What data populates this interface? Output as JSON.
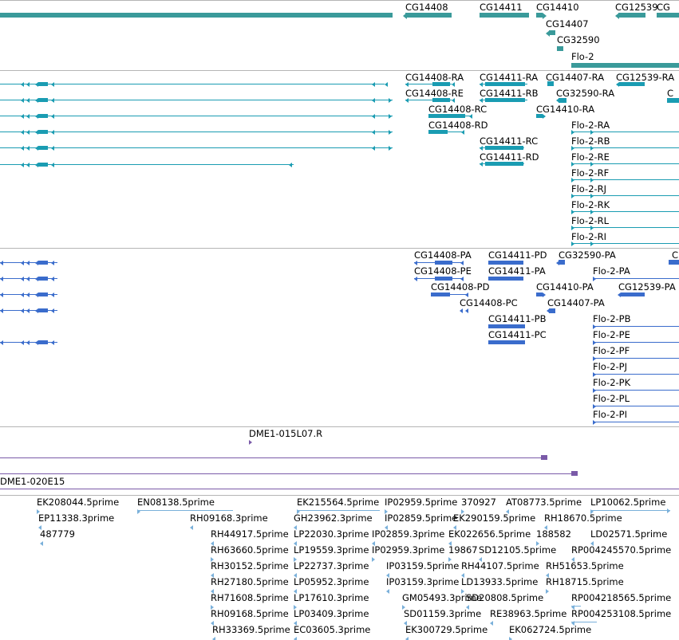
{
  "colors": {
    "gene": "#3a9a9a",
    "transcript": "#1a9cb2",
    "protein": "#3a6ccc",
    "clone": "#7a5aa8",
    "est": "#7ab0da",
    "separator": "#b5b5b5"
  },
  "tracks": {
    "genes": {
      "labels": [
        "CG14408",
        "CG14411",
        "CG14410",
        "CG14407",
        "CG12539",
        "CG32590",
        "Flo-2",
        "CG"
      ]
    },
    "transcripts": {
      "labels": [
        "CG14408-RA",
        "CG14408-RE",
        "CG14408-RC",
        "CG14408-RD",
        "CG14411-RA",
        "CG14411-RB",
        "CG14411-RC",
        "CG14411-RD",
        "CG14407-RA",
        "CG14410-RA",
        "CG12539-RA",
        "CG32590-RA",
        "Flo-2-RA",
        "Flo-2-RB",
        "Flo-2-RE",
        "Flo-2-RF",
        "Flo-2-RJ",
        "Flo-2-RK",
        "Flo-2-RL",
        "Flo-2-RI",
        "C"
      ]
    },
    "proteins": {
      "labels": [
        "CG14408-PA",
        "CG14408-PE",
        "CG14408-PD",
        "CG14408-PC",
        "CG14411-PD",
        "CG14411-PA",
        "CG14411-PB",
        "CG14411-PC",
        "CG32590-PA",
        "CG14410-PA",
        "CG12539-PA",
        "CG14407-PA",
        "Flo-2-PA",
        "Flo-2-PB",
        "Flo-2-PE",
        "Flo-2-PF",
        "Flo-2-PJ",
        "Flo-2-PK",
        "Flo-2-PL",
        "Flo-2-PI",
        "C"
      ]
    },
    "clones": {
      "labels": [
        "DME1-015L07.R",
        "DME1-020E15"
      ]
    },
    "ests": {
      "labels": [
        "EK208044.5prime",
        "EP11338.3prime",
        "487779",
        "EN08138.5prime",
        "RH09168.3prime",
        "RH44917.5prime",
        "RH63660.5prime",
        "RH30152.5prime",
        "RH27180.5prime",
        "RH71608.5prime",
        "RH09168.5prime",
        "RH33369.5prime",
        "EK215564.5prime",
        "GH23962.3prime",
        "LP22030.3prime",
        "LP19559.3prime",
        "LP22737.3prime",
        "LP05952.3prime",
        "LP17610.3prime",
        "LP03409.3prime",
        "EC03605.3prime",
        "IP02959.5prime",
        "IP02859.5prime",
        "IP02859.3prime",
        "IP02959.3prime",
        "IP03159.5prime",
        "IP03159.3prime",
        "GM05493.3prime",
        "SD01159.3prime",
        "EK300729.5prime",
        "370927",
        "EK290159.5prime",
        "EK022656.5prime",
        "19867",
        "SD12105.5prime",
        "RH44107.5prime",
        "LD13933.5prime",
        "SD20808.5prime",
        "RE38963.5prime",
        "EK062724.5prime",
        "AT08773.5prime",
        "RH18670.5prime",
        "188582",
        "RP004245570.5prime",
        "RH51653.5prime",
        "RH18715.5prime",
        "RP004218565.5prime",
        "RP004253108.5prime",
        "LP10062.5prime",
        "LD02571.5prime"
      ]
    }
  }
}
